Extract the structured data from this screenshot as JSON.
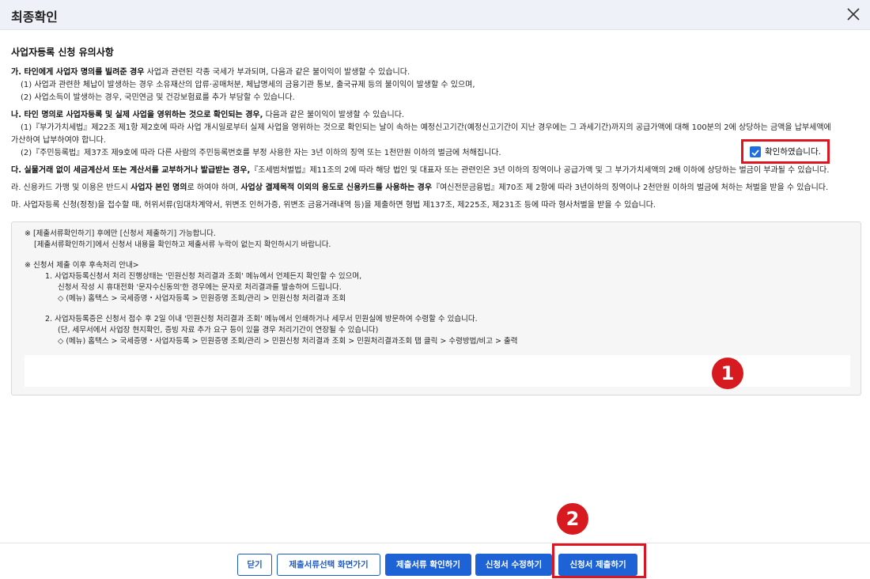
{
  "dialog": {
    "title": "최종확인"
  },
  "notice": {
    "heading": "사업자등록 신청 유의사항",
    "items": [
      {
        "lead": "가. 타인에게 사업자 명의를 빌려준 경우",
        "rest": " 사업과 관련된 각종 국세가 부과되며, 다음과 같은 불이익이 발생할 수 있습니다."
      },
      {
        "text": "(1) 사업과 관련한 체납이 발생하는 경우 소유재산의 압류·공매처분, 체납명세의 금융기관 통보, 출국규제 등의 불이익이 발생할 수 있으며,"
      },
      {
        "text": "(2) 사업소득이 발생하는 경우, 국민연금 및 건강보험료를 추가 부담할 수 있습니다."
      },
      {
        "lead": "나. 타인 명의로 사업자등록 및 실제 사업을 영위하는 것으로 확인되는 경우,",
        "rest": " 다음과 같은 불이익이 발생할 수 있습니다."
      },
      {
        "text": "(1)『부가가치세법』제22조 제1항 제2호에 따라 사업 개시일로부터 실제 사업을 영위하는 것으로 확인되는 날이 속하는 예정신고기간(예정신고기간이 지난 경우에는 그 과세기간)까지의 공급가액에 대해 100분의 2에 상당하는 금액을 납부세액에"
      },
      {
        "text": "가산하여 납부하여야 합니다."
      },
      {
        "text": "(2)『주민등록법』제37조 제9호에 따라 다른 사람의 주민등록번호를 부정 사용한 자는 3년 이하의 징역 또는 1천만원 이하의 벌금에 처해집니다."
      },
      {
        "lead": "다. 실물거래 없이 세금계산서 또는 계산서를 교부하거나 발급받는 경우,",
        "rest": "『조세범처벌법』제11조의 2에 따라 해당 법인 및 대표자 또는 관련인은 3년 이하의 징역이나 공급가액 및 그 부가가치세액의 2배 이하에 상당하는 벌금이 부과될 수 있습니다."
      },
      {
        "pre": "라. 신용카드 가맹 및 이용은 반드시 ",
        "b1": "사업자 본인 명의",
        "mid": "로 하여야 하며, ",
        "b2": "사업상 결제목적 이외의 용도로 신용카드를 사용하는 경우",
        "post": "『여신전문금융법』제70조 제 2항에 따라 3년이하의 징역이나 2천만원 이하의 벌금에 처하는 처벌을 받을 수 있습니다."
      },
      {
        "pre": "마. ",
        "post2": "사업자등록 신청(정정)을 접수할 때, 허위서류(임대차계약서, 위변조 인허가증, 위변조 금융거래내역 등)을 제출하면 형법 제137조, 제225조, 제231조 등에 따라 형사처벌을 받을 수 있습니다."
      }
    ]
  },
  "info": {
    "lines": [
      "※ [제출서류확인하기] 후에만 [신청서 제출하기] 가능합니다.",
      "[제출서류확인하기]에서 신청서 내용을 확인하고 제출서류 누락이 없는지 확인하시기 바랍니다.",
      "※ 신청서 제출 이후 후속처리 안내>",
      "1.  사업자등록신청서 처리 진행상태는 '민원신청 처리결과 조회' 메뉴에서 언제든지 확인할 수 있으며,",
      "신청서 작성 시 휴대전화 '문자수신동의'한 경우에는 문자로 처리결과를 발송하여 드립니다.",
      "◇ (메뉴) 홈택스 > 국세증명・사업자등록 > 민원증명 조회/관리 > 민원신청 처리결과 조회",
      "2.  사업자등록증은 신청서 접수 후 2일 이내 '민원신청 처리결과 조회' 메뉴에서 인쇄하거나 세무서 민원실에 방문하여 수령할 수 있습니다.",
      "(단, 세무서에서 사업장 현지확인, 증빙 자료 추가 요구 등이 있을 경우 처리기간이 연장될 수 있습니다)",
      "◇ (메뉴) 홈택스 > 국세증명・사업자등록 > 민원증명 조회/관리 > 민원신청 처리결과 조회 > 민원처리결과조회 탭 클릭 > 수령방법/비고 > 출력"
    ],
    "confirm_label": "확인하였습니다.",
    "confirm_checked": true
  },
  "markers": {
    "one": "1",
    "two": "2"
  },
  "buttons": {
    "close": "닫기",
    "goto_docs": "제출서류선택 화면가기",
    "check_docs": "제출서류 확인하기",
    "edit_app": "신청서 수정하기",
    "submit_app": "신청서 제출하기"
  },
  "colors": {
    "primary": "#1e63d6",
    "highlight": "#e0141e",
    "marker": "#d71920"
  },
  "icons": {
    "close": "close-icon",
    "check": "check-icon"
  }
}
